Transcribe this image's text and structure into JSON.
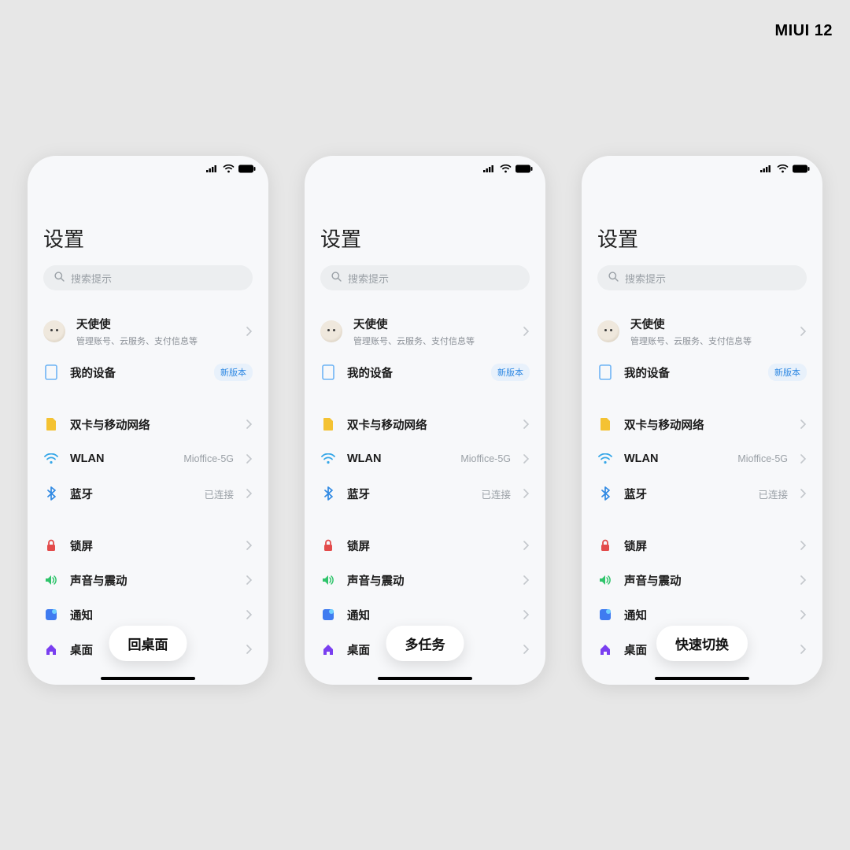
{
  "brand": "MIUI 12",
  "phones": [
    {
      "gesture_label": "回桌面"
    },
    {
      "gesture_label": "多任务"
    },
    {
      "gesture_label": "快速切换"
    }
  ],
  "settings": {
    "title": "设置",
    "search_placeholder": "搜索提示",
    "account": {
      "name": "天使使",
      "subtitle": "管理账号、云服务、支付信息等"
    },
    "my_device": {
      "label": "我的设备",
      "badge": "新版本"
    },
    "items": {
      "sim": {
        "label": "双卡与移动网络"
      },
      "wlan": {
        "label": "WLAN",
        "value": "Mioffice-5G"
      },
      "bluetooth": {
        "label": "蓝牙",
        "value": "已连接"
      },
      "lock": {
        "label": "锁屏"
      },
      "sound": {
        "label": "声音与震动"
      },
      "notify": {
        "label": "通知"
      },
      "desktop": {
        "label": "桌面"
      }
    },
    "colors": {
      "device": "#6fb4f5",
      "sim": "#f4c232",
      "wlan": "#36a7e8",
      "bt": "#2f89e3",
      "lock": "#e34b4b",
      "sound": "#2fc46b",
      "notify": "#3f7bf0",
      "desktop": "#7a3ff0"
    }
  }
}
